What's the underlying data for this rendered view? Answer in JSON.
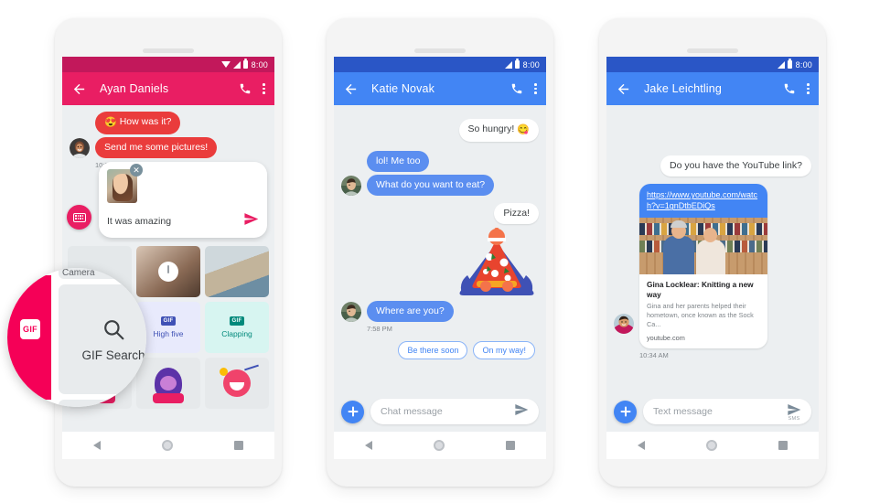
{
  "phones": [
    {
      "id": "phone-ayan",
      "theme": "red",
      "accent": "#e91e63",
      "status": {
        "time": "8:00",
        "wifi": "wifi-icon",
        "signal": "signal-icon",
        "battery": "battery-icon"
      },
      "appbar": {
        "title": "Ayan Daniels",
        "back": "back-arrow-icon",
        "call": "phone-call-icon",
        "more": "overflow-menu-icon"
      },
      "messages": [
        {
          "side": "in",
          "text": "How was it?",
          "emoji": "😍",
          "style": "red"
        },
        {
          "side": "in",
          "text": "Send me some pictures!",
          "style": "red"
        }
      ],
      "timestamp": "10:36 AM",
      "compose": {
        "text": "It was amazing",
        "remove": "remove-attachment-icon",
        "send": "send-icon",
        "keyboard": "keyboard-icon"
      },
      "tray": [
        {
          "type": "camera",
          "label": "Camera"
        },
        {
          "type": "photo",
          "label": ""
        },
        {
          "type": "photo",
          "label": ""
        },
        {
          "type": "gif-search",
          "label": "GIF Search"
        },
        {
          "type": "gif",
          "label": "High five"
        },
        {
          "type": "gif",
          "label": "Clapping"
        },
        {
          "type": "sticker",
          "label": ""
        },
        {
          "type": "sticker",
          "label": ""
        },
        {
          "type": "sticker",
          "label": ""
        }
      ],
      "magnifier": {
        "badge": "GIF",
        "label": "GIF Search",
        "search_icon": "search-icon",
        "top_label": "Camera"
      }
    },
    {
      "id": "phone-katie",
      "theme": "blue",
      "accent": "#4285f4",
      "status": {
        "time": "8:00",
        "signal": "signal-icon",
        "battery": "battery-icon"
      },
      "appbar": {
        "title": "Katie Novak",
        "back": "back-arrow-icon",
        "call": "phone-call-icon",
        "more": "overflow-menu-icon"
      },
      "messages": [
        {
          "side": "out",
          "text": "So hungry!",
          "emoji": "😋",
          "style": "white"
        },
        {
          "side": "in",
          "text": "lol! Me too",
          "style": "blue"
        },
        {
          "side": "in",
          "text": "What do you want to eat?",
          "style": "blue"
        },
        {
          "side": "out",
          "text": "Pizza!",
          "style": "white"
        },
        {
          "side": "out",
          "text": "",
          "style": "sticker",
          "sticker": "pizza-sticker"
        },
        {
          "side": "in",
          "text": "Where are you?",
          "style": "blue"
        }
      ],
      "timestamp": "7:58 PM",
      "chips": [
        "Be there soon",
        "On my way!"
      ],
      "input": {
        "placeholder": "Chat message",
        "plus": "add-attachment-icon",
        "send": "send-icon"
      }
    },
    {
      "id": "phone-jake",
      "theme": "blue",
      "accent": "#4285f4",
      "status": {
        "time": "8:00",
        "signal": "signal-icon",
        "battery": "battery-icon"
      },
      "appbar": {
        "title": "Jake Leichtling",
        "back": "back-arrow-icon",
        "call": "phone-call-icon",
        "more": "overflow-menu-icon"
      },
      "messages": [
        {
          "side": "out",
          "text": "Do you have the YouTube link?",
          "style": "white"
        }
      ],
      "link_card": {
        "url": "https://www.youtube.com/watch?v=1gnDtbEDiQs",
        "title": "Gina Locklear: Knitting a new way",
        "description": "Gina and her parents helped their hometown, once known as the Sock Ca...",
        "site": "youtube.com"
      },
      "timestamp": "10:34 AM",
      "input": {
        "placeholder": "Text message",
        "plus": "add-attachment-icon",
        "send": "send-icon",
        "send_label": "SMS"
      }
    }
  ],
  "navbar": {
    "back": "nav-back-icon",
    "home": "nav-home-icon",
    "recents": "nav-recents-icon"
  }
}
